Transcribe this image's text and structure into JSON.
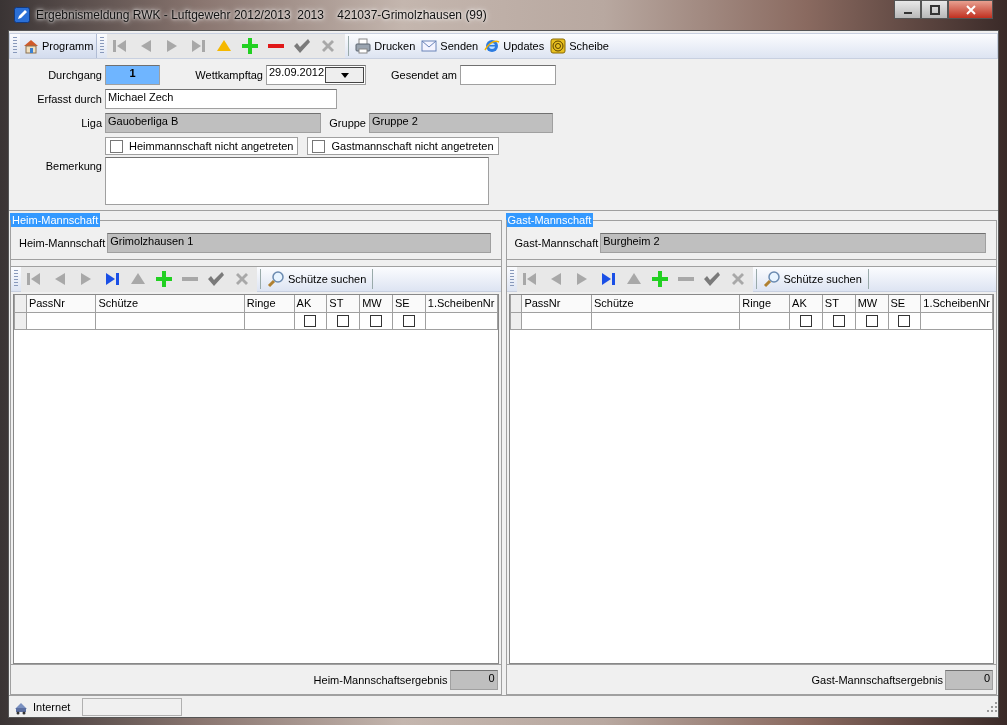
{
  "window": {
    "title": "Ergebnismeldung RWK - Luftgewehr 2012/2013  2013    421037-Grimolzhausen (99)"
  },
  "toolbar": {
    "menu_button": "Programm",
    "nav": [
      {
        "kind": "first",
        "disabled": true
      },
      {
        "kind": "prev",
        "disabled": true
      },
      {
        "kind": "next",
        "disabled": true
      },
      {
        "kind": "last",
        "disabled": true
      },
      {
        "kind": "up",
        "disabled": false
      },
      {
        "kind": "plus",
        "disabled": false
      },
      {
        "kind": "minus",
        "disabled": false
      },
      {
        "kind": "check",
        "disabled": true
      },
      {
        "kind": "cancel",
        "disabled": true
      }
    ],
    "actions": [
      {
        "kind": "print",
        "label": "Drucken"
      },
      {
        "kind": "mail",
        "label": "Senden"
      },
      {
        "kind": "globe",
        "label": "Updates"
      },
      {
        "kind": "target",
        "label": "Scheibe"
      }
    ]
  },
  "form": {
    "durchgang": {
      "label": "Durchgang",
      "value": "1",
      "focused": true
    },
    "wettkampftag": {
      "label": "Wettkampftag",
      "value": "29.09.2012"
    },
    "gesendet_am": {
      "label": "Gesendet am"
    },
    "erfasst_durch": {
      "label": "Erfasst durch",
      "value": "Michael Zech"
    },
    "liga": {
      "label": "Liga",
      "value": "Gauoberliga B",
      "disabled": true
    },
    "gruppe": {
      "label": "Gruppe",
      "value": "Gruppe 2",
      "disabled": true
    },
    "options": [
      {
        "label": "Heimmannschaft nicht angetreten",
        "checked": false
      },
      {
        "label": "Gastmannschaft nicht angetreten",
        "checked": false
      }
    ],
    "bemerkung": {
      "label": "Bemerkung"
    }
  },
  "teams": [
    {
      "legend": "Heim-Mannschaft",
      "team_label": "Heim-Mannschaft",
      "team_value": "Grimolzhausen 1",
      "nav": [
        {
          "kind": "first",
          "disabled": true
        },
        {
          "kind": "prev",
          "disabled": true
        },
        {
          "kind": "next",
          "disabled": true
        },
        {
          "kind": "last",
          "disabled": false
        },
        {
          "kind": "up",
          "disabled": true
        },
        {
          "kind": "plus",
          "disabled": false
        },
        {
          "kind": "minus",
          "disabled": true
        },
        {
          "kind": "check",
          "disabled": true
        },
        {
          "kind": "cancel",
          "disabled": true
        }
      ],
      "search_button": "Schütze suchen",
      "columns": [
        {
          "label": "PassNr",
          "kind": "text"
        },
        {
          "label": "Schütze",
          "kind": "text"
        },
        {
          "label": "Ringe",
          "kind": "text"
        },
        {
          "label": "AK",
          "kind": "check"
        },
        {
          "label": "ST",
          "kind": "check"
        },
        {
          "label": "MW",
          "kind": "check"
        },
        {
          "label": "SE",
          "kind": "check"
        },
        {
          "label": "1.ScheibenNr",
          "kind": "text"
        }
      ],
      "rows": [
        {
          "checks": [
            false,
            false,
            false,
            false
          ]
        }
      ],
      "result_label": "Heim-Mannschaftsergebnis",
      "result_value": "0"
    },
    {
      "legend": "Gast-Mannschaft",
      "team_label": "Gast-Mannschaft",
      "team_value": "Burgheim 2",
      "nav": [
        {
          "kind": "first",
          "disabled": true
        },
        {
          "kind": "prev",
          "disabled": true
        },
        {
          "kind": "next",
          "disabled": true
        },
        {
          "kind": "last",
          "disabled": false
        },
        {
          "kind": "up",
          "disabled": true
        },
        {
          "kind": "plus",
          "disabled": false
        },
        {
          "kind": "minus",
          "disabled": true
        },
        {
          "kind": "check",
          "disabled": true
        },
        {
          "kind": "cancel",
          "disabled": true
        }
      ],
      "search_button": "Schütze suchen",
      "columns": [
        {
          "label": "PassNr",
          "kind": "text"
        },
        {
          "label": "Schütze",
          "kind": "text"
        },
        {
          "label": "Ringe",
          "kind": "text"
        },
        {
          "label": "AK",
          "kind": "check"
        },
        {
          "label": "ST",
          "kind": "check"
        },
        {
          "label": "MW",
          "kind": "check"
        },
        {
          "label": "SE",
          "kind": "check"
        },
        {
          "label": "1.ScheibenNr",
          "kind": "text"
        }
      ],
      "rows": [
        {
          "checks": [
            false,
            false,
            false,
            false
          ]
        }
      ],
      "result_label": "Gast-Mannschaftsergebnis",
      "result_value": "0"
    }
  ],
  "status_bar": {
    "text": "Internet"
  }
}
